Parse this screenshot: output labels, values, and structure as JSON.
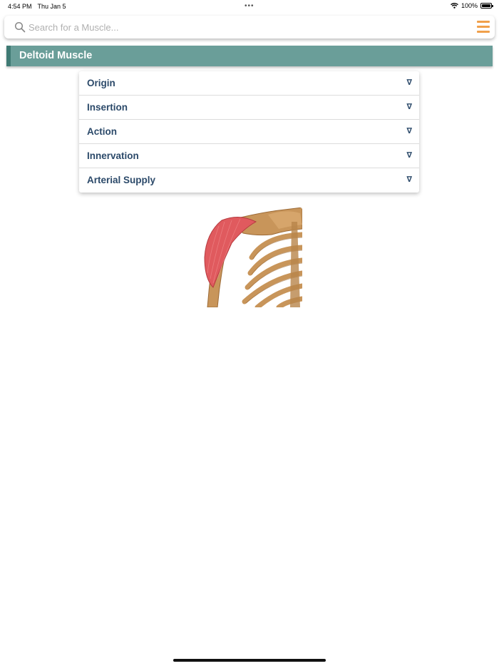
{
  "status_bar": {
    "time": "4:54 PM",
    "date": "Thu Jan 5",
    "battery": "100%"
  },
  "search": {
    "placeholder": "Search for a Muscle..."
  },
  "title": "Deltoid Muscle",
  "accordion": [
    {
      "label": "Origin",
      "arrow": "∇"
    },
    {
      "label": "Insertion",
      "arrow": "∇"
    },
    {
      "label": "Action",
      "arrow": "∇"
    },
    {
      "label": "Innervation",
      "arrow": "∇"
    },
    {
      "label": "Arterial Supply",
      "arrow": "∇"
    }
  ],
  "colors": {
    "accent": "#f0a04b",
    "header_bg": "#6a9e99",
    "header_border": "#3f7a74",
    "label": "#2c4a6a",
    "muscle": "#e05a5e",
    "bone": "#c8955a"
  },
  "icons": {
    "search": "search-icon",
    "menu": "hamburger-menu-icon",
    "wifi": "wifi-icon",
    "battery": "battery-icon",
    "expand": "triangle-down-icon"
  }
}
